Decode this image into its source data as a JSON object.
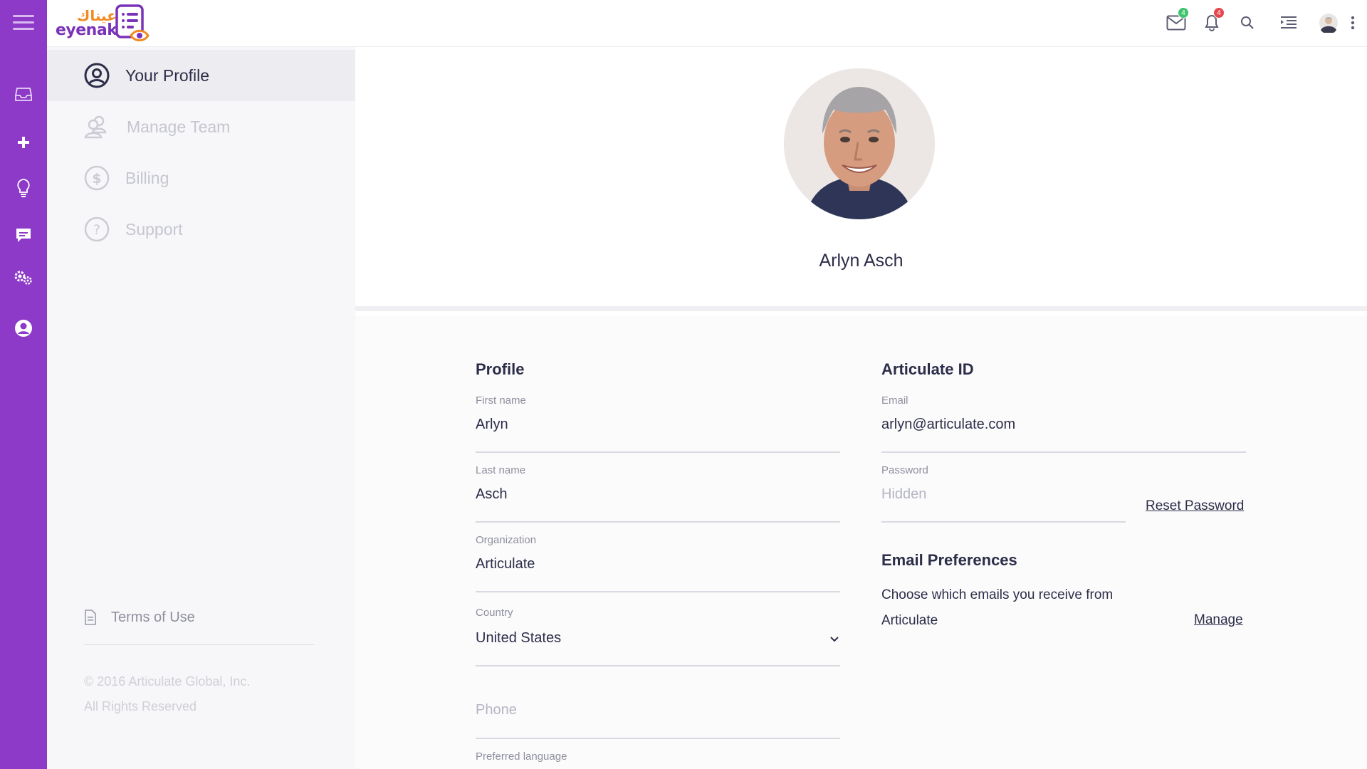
{
  "brand": {
    "arabic": "عيناك",
    "latin": "eyenak"
  },
  "topbar": {
    "mail_count": "4",
    "notification_count": "4"
  },
  "sidebar": {
    "items": [
      {
        "label": "Your Profile",
        "icon": "user-circle-icon"
      },
      {
        "label": "Manage Team",
        "icon": "team-icon"
      },
      {
        "label": "Billing",
        "icon": "dollar-icon"
      },
      {
        "label": "Support",
        "icon": "question-icon"
      }
    ],
    "terms": "Terms of Use",
    "copyright_line1": "© 2016 Articulate Global, Inc.",
    "copyright_line2": "All Rights Reserved"
  },
  "profile": {
    "full_name": "Arlyn Asch",
    "section_title": "Profile",
    "first_name_label": "First name",
    "first_name": "Arlyn",
    "last_name_label": "Last name",
    "last_name": "Asch",
    "organization_label": "Organization",
    "organization": "Articulate",
    "country_label": "Country",
    "country": "United States",
    "phone_placeholder": "Phone",
    "preferred_language_label": "Preferred language"
  },
  "articulate_id": {
    "section_title": "Articulate ID",
    "email_label": "Email",
    "email": "arlyn@articulate.com",
    "password_label": "Password",
    "password_placeholder": "Hidden",
    "reset_password": "Reset Password"
  },
  "email_preferences": {
    "section_title": "Email Preferences",
    "description": "Choose which emails you receive from Articulate",
    "manage": "Manage"
  },
  "colors": {
    "rail": "#8d3ac8",
    "brand_orange": "#f28a22",
    "brand_purple": "#7a32b8",
    "badge_green": "#3ec46d",
    "badge_red": "#e8464f"
  }
}
